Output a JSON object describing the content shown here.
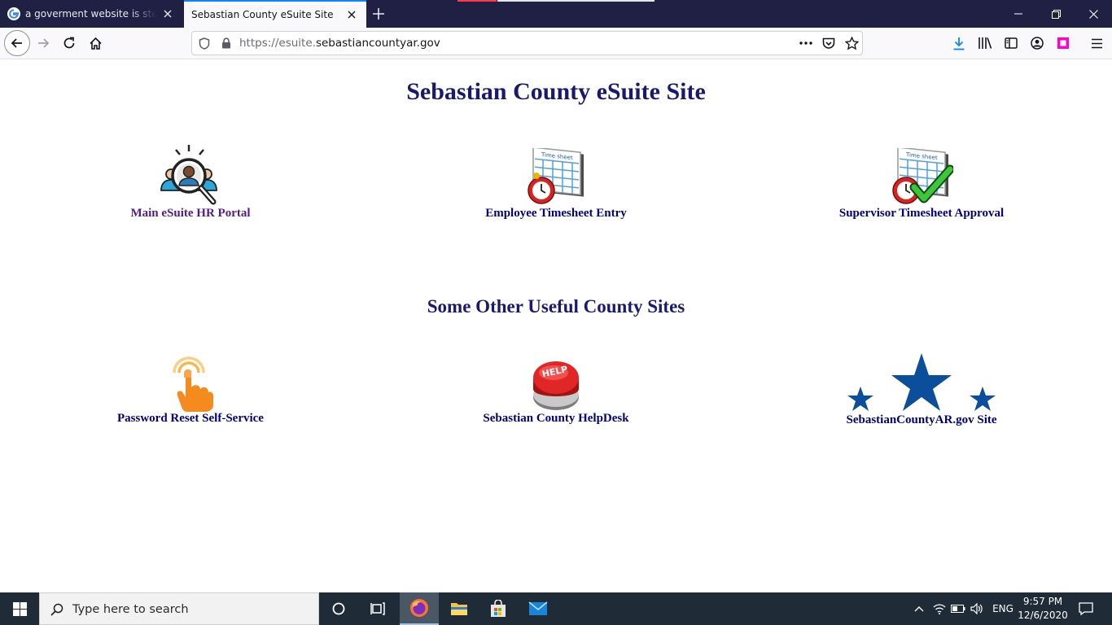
{
  "browser": {
    "tabs": [
      {
        "title": "a goverment website is stealing",
        "favicon": "google-g-icon",
        "active": false
      },
      {
        "title": "Sebastian County eSuite Site",
        "favicon": "none",
        "active": true
      }
    ],
    "url": {
      "prefix": "https://esuite.",
      "domain": "sebastiancountyar.gov"
    },
    "accent": "#0a84ff"
  },
  "page": {
    "title": "Sebastian County eSuite Site",
    "primary_links": [
      {
        "label": "Main eSuite HR Portal",
        "icon": "hr-search-people-icon"
      },
      {
        "label": "Employee Timesheet Entry",
        "icon": "timesheet-clock-icon"
      },
      {
        "label": "Supervisor Timesheet Approval",
        "icon": "timesheet-approval-check-icon"
      }
    ],
    "section_heading": "Some Other Useful County Sites",
    "secondary_links": [
      {
        "label": "Password Reset Self-Service",
        "icon": "tap-finger-icon"
      },
      {
        "label": "Sebastian County HelpDesk",
        "icon": "help-button-icon",
        "icon_text": "HELP"
      },
      {
        "label": "SebastianCountyAR.gov Site",
        "icon": "three-stars-icon"
      }
    ],
    "colors": {
      "heading": "#191970",
      "link": "#000080",
      "visited_link": "#551a8b",
      "star": "#0b4f9c"
    }
  },
  "taskbar": {
    "search_placeholder": "Type here to search",
    "language": "ENG",
    "time": "9:57 PM",
    "date": "12/6/2020"
  }
}
